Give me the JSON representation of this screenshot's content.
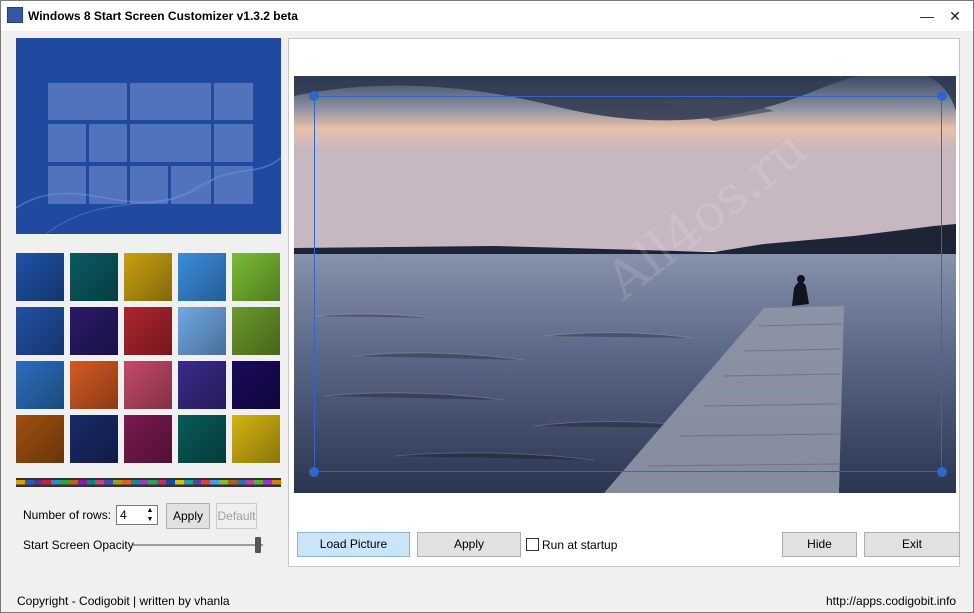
{
  "window": {
    "title": "Windows 8 Start Screen Customizer v1.3.2 beta",
    "minimize": "—",
    "close": "✕"
  },
  "left_panel": {
    "rows_label": "Number of rows:",
    "rows_value": "4",
    "apply_label": "Apply",
    "default_label": "Default",
    "opacity_label": "Start Screen Opacity",
    "opacity_value": 0.97,
    "backgrounds": [
      {
        "name": "blue-lines",
        "color": "#1f52a8"
      },
      {
        "name": "teal-grid",
        "color": "#0b5b63"
      },
      {
        "name": "yellow-swirl",
        "color": "#c9a012"
      },
      {
        "name": "light-blue-floral",
        "color": "#3a8de0"
      },
      {
        "name": "green-circles",
        "color": "#7bbd35"
      },
      {
        "name": "blue-waves",
        "color": "#2250a4"
      },
      {
        "name": "purple-doodle",
        "color": "#2a1a6a"
      },
      {
        "name": "red-target",
        "color": "#b0252e"
      },
      {
        "name": "light-blue-geo",
        "color": "#6fa9e6"
      },
      {
        "name": "olive-pattern",
        "color": "#6b9a2a"
      },
      {
        "name": "colorful-wave",
        "color": "#2b6fbf"
      },
      {
        "name": "orange-swirl",
        "color": "#d45a22"
      },
      {
        "name": "pink-flower",
        "color": "#c54a6a"
      },
      {
        "name": "game-scene",
        "color": "#3a2a8a"
      },
      {
        "name": "dark-purple",
        "color": "#1a0a5a"
      },
      {
        "name": "guitar",
        "color": "#a05010"
      },
      {
        "name": "blue-feather",
        "color": "#1a2a6a"
      },
      {
        "name": "magenta-confetti",
        "color": "#7a1a50"
      },
      {
        "name": "teal-rings",
        "color": "#0a5a5a"
      },
      {
        "name": "yellow-horn",
        "color": "#d4b410"
      }
    ],
    "palette": [
      "#d4a00a",
      "#2060c0",
      "#603090",
      "#c02040",
      "#2090d0",
      "#30a040",
      "#c06010",
      "#8020a0",
      "#108080",
      "#d04080",
      "#4050b0",
      "#a0a010",
      "#e06020",
      "#2080a0",
      "#9040c0",
      "#30a060",
      "#c03060",
      "#1050a0",
      "#d0c010",
      "#20a0a0",
      "#6040a0",
      "#e04040",
      "#40a0e0",
      "#80c020",
      "#b06020",
      "#3070b0",
      "#c040a0",
      "#60b040",
      "#a030d0",
      "#d08010"
    ]
  },
  "right_panel": {
    "load_picture_label": "Load Picture",
    "apply_label": "Apply",
    "run_at_startup_label": "Run at startup",
    "run_at_startup_checked": false,
    "hide_label": "Hide",
    "exit_label": "Exit",
    "watermark": "All4os.ru"
  },
  "footer": {
    "copyright": "Copyright - Codigobit | written by vhanla",
    "url": "http://apps.codigobit.info"
  }
}
